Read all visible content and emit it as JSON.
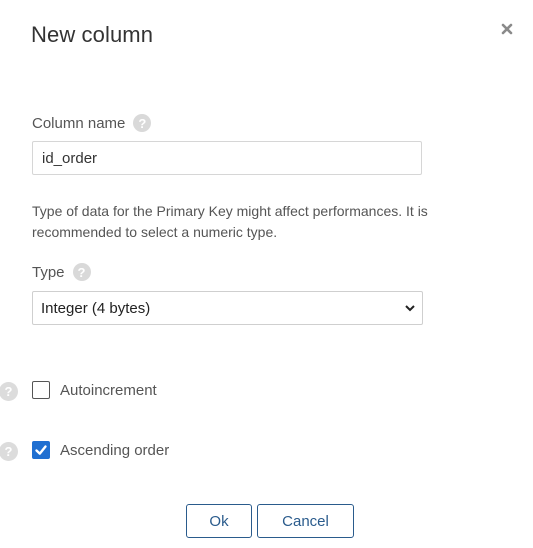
{
  "dialog": {
    "title": "New column",
    "close_icon": "close-icon"
  },
  "column_name": {
    "label": "Column name",
    "value": "id_order",
    "help_icon": "help-icon"
  },
  "note": "Type of data for the Primary Key might affect performances. It is recommended to select a numeric type.",
  "type": {
    "label": "Type",
    "selected": "Integer (4 bytes)",
    "help_icon": "help-icon"
  },
  "options": [
    {
      "label": "Autoincrement",
      "checked": false
    },
    {
      "label": "Ascending order",
      "checked": true
    }
  ],
  "buttons": {
    "ok": "Ok",
    "cancel": "Cancel"
  },
  "colors": {
    "accent": "#2a5b8c",
    "checkbox_checked": "#1f6fd1",
    "help_icon_bg": "#d9d9d9"
  }
}
